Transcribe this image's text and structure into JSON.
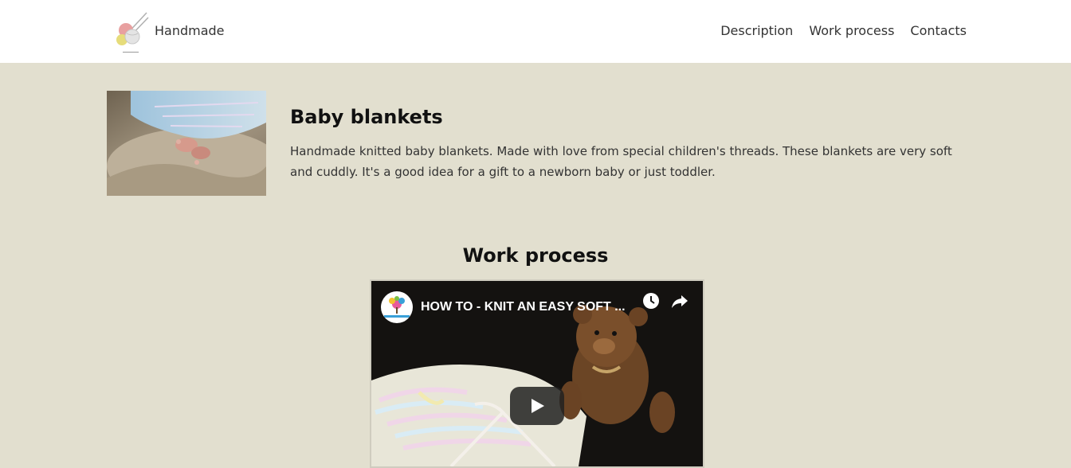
{
  "header": {
    "brand": "Handmade",
    "logo_icon": "yarn-balls-needles-icon",
    "nav": [
      {
        "label": "Description"
      },
      {
        "label": "Work process"
      },
      {
        "label": "Contacts"
      }
    ]
  },
  "product": {
    "image": "baby-feet-blanket-photo",
    "title": "Baby blankets",
    "description": "Handmade knitted baby blankets. Made with love from special children's threads. These blankets are very soft and cuddly. It's a good idea for a gift to a newborn baby or just toddler."
  },
  "work_process": {
    "title": "Work process",
    "video": {
      "title": "HOW TO - KNIT AN EASY SOFT ...",
      "channel_icon": "channel-tree-icon",
      "watch_later_icon": "clock-icon",
      "share_icon": "share-arrow-icon",
      "play_icon": "play-icon"
    }
  },
  "colors": {
    "page_background": "#e2dfcf",
    "header_background": "#ffffff",
    "play_button": "#212121"
  }
}
